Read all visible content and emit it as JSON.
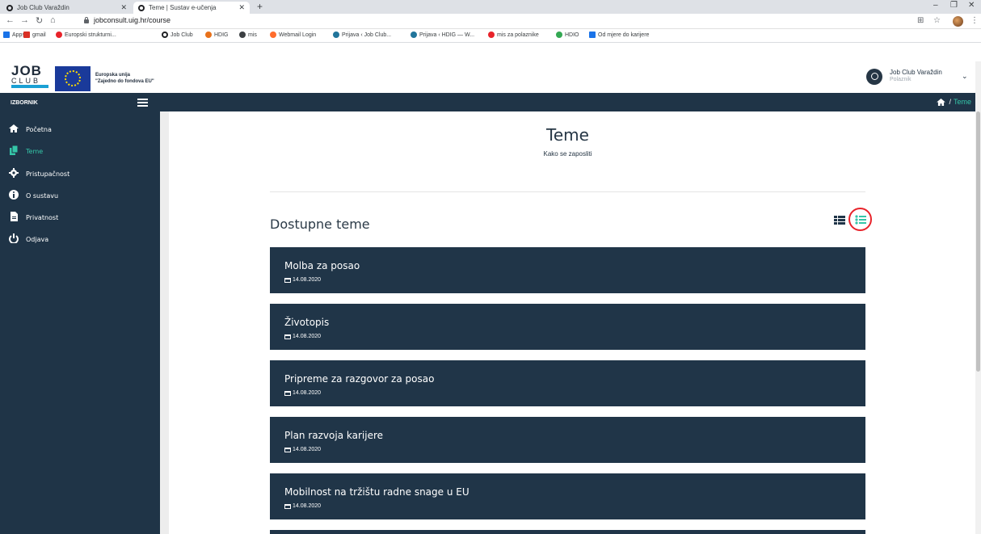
{
  "browser": {
    "tabs": [
      {
        "title": "Job Club Varaždin",
        "active": false
      },
      {
        "title": "Teme | Sustav e-učenja",
        "active": true
      }
    ],
    "new_tab": "+",
    "url": "jobconsult.uig.hr/course",
    "bookmarks": [
      {
        "label": "Apps",
        "icon": "apps-grid-icon",
        "color": "#1a73e8"
      },
      {
        "label": "gmail",
        "icon": "gmail-icon",
        "color": "#d93025"
      },
      {
        "label": "Europski strukturni...",
        "icon": "eu-funds-icon",
        "color": "#e8232a"
      },
      {
        "label": "Job Club",
        "icon": "job-club-icon",
        "color": "#202124"
      },
      {
        "label": "HDIG",
        "icon": "google-icon",
        "color": "#e8711a"
      },
      {
        "label": "mis",
        "icon": "globe-icon",
        "color": "#3c4043"
      },
      {
        "label": "Webmail Login",
        "icon": "cpanel-icon",
        "color": "#ff6c2c"
      },
      {
        "label": "Prijava ‹ Job Club...",
        "icon": "wordpress-icon",
        "color": "#21759b"
      },
      {
        "label": "Prijava ‹ HDIG — W...",
        "icon": "wordpress-icon",
        "color": "#21759b"
      },
      {
        "label": "mis za polaznike",
        "icon": "mis-icon",
        "color": "#e8232a"
      },
      {
        "label": "HDIO",
        "icon": "hdio-icon",
        "color": "#34a853"
      },
      {
        "label": "Od mjere do karijere",
        "icon": "puzzle-icon",
        "color": "#1a73e8"
      }
    ]
  },
  "header": {
    "logo_top": "JOB",
    "logo_bottom": "CLUB",
    "eu_line1": "Europska unija",
    "eu_line2": "\"Zajedno do fondova EU\"",
    "user_name": "Job Club Varaždin",
    "user_role": "Polaznik"
  },
  "topbar": {
    "menu_label": "IZBORNIK",
    "breadcrumb_sep": "/",
    "breadcrumb_current": "Teme"
  },
  "sidebar": {
    "items": [
      {
        "label": "Početna",
        "icon": "home-icon",
        "active": false
      },
      {
        "label": "Teme",
        "icon": "copy-icon",
        "active": true
      },
      {
        "label": "Pristupačnost",
        "icon": "cog-icon",
        "active": false
      },
      {
        "label": "O sustavu",
        "icon": "info-icon",
        "active": false
      },
      {
        "label": "Privatnost",
        "icon": "file-icon",
        "active": false
      },
      {
        "label": "Odjava",
        "icon": "power-icon",
        "active": false
      }
    ]
  },
  "main": {
    "title": "Teme",
    "subtitle": "Kako se zaposliti",
    "section_title": "Dostupne teme",
    "courses": [
      {
        "title": "Molba za posao",
        "date": "14.08.2020"
      },
      {
        "title": "Životopis",
        "date": "14.08.2020"
      },
      {
        "title": "Pripreme za razgovor za posao",
        "date": "14.08.2020"
      },
      {
        "title": "Plan razvoja karijere",
        "date": "14.08.2020"
      },
      {
        "title": "Mobilnost na tržištu radne snage u EU",
        "date": "14.08.2020"
      }
    ]
  },
  "colors": {
    "dark_navy": "#1f3447",
    "accent_teal": "#35c6a8",
    "highlight_red": "#e8232a"
  }
}
